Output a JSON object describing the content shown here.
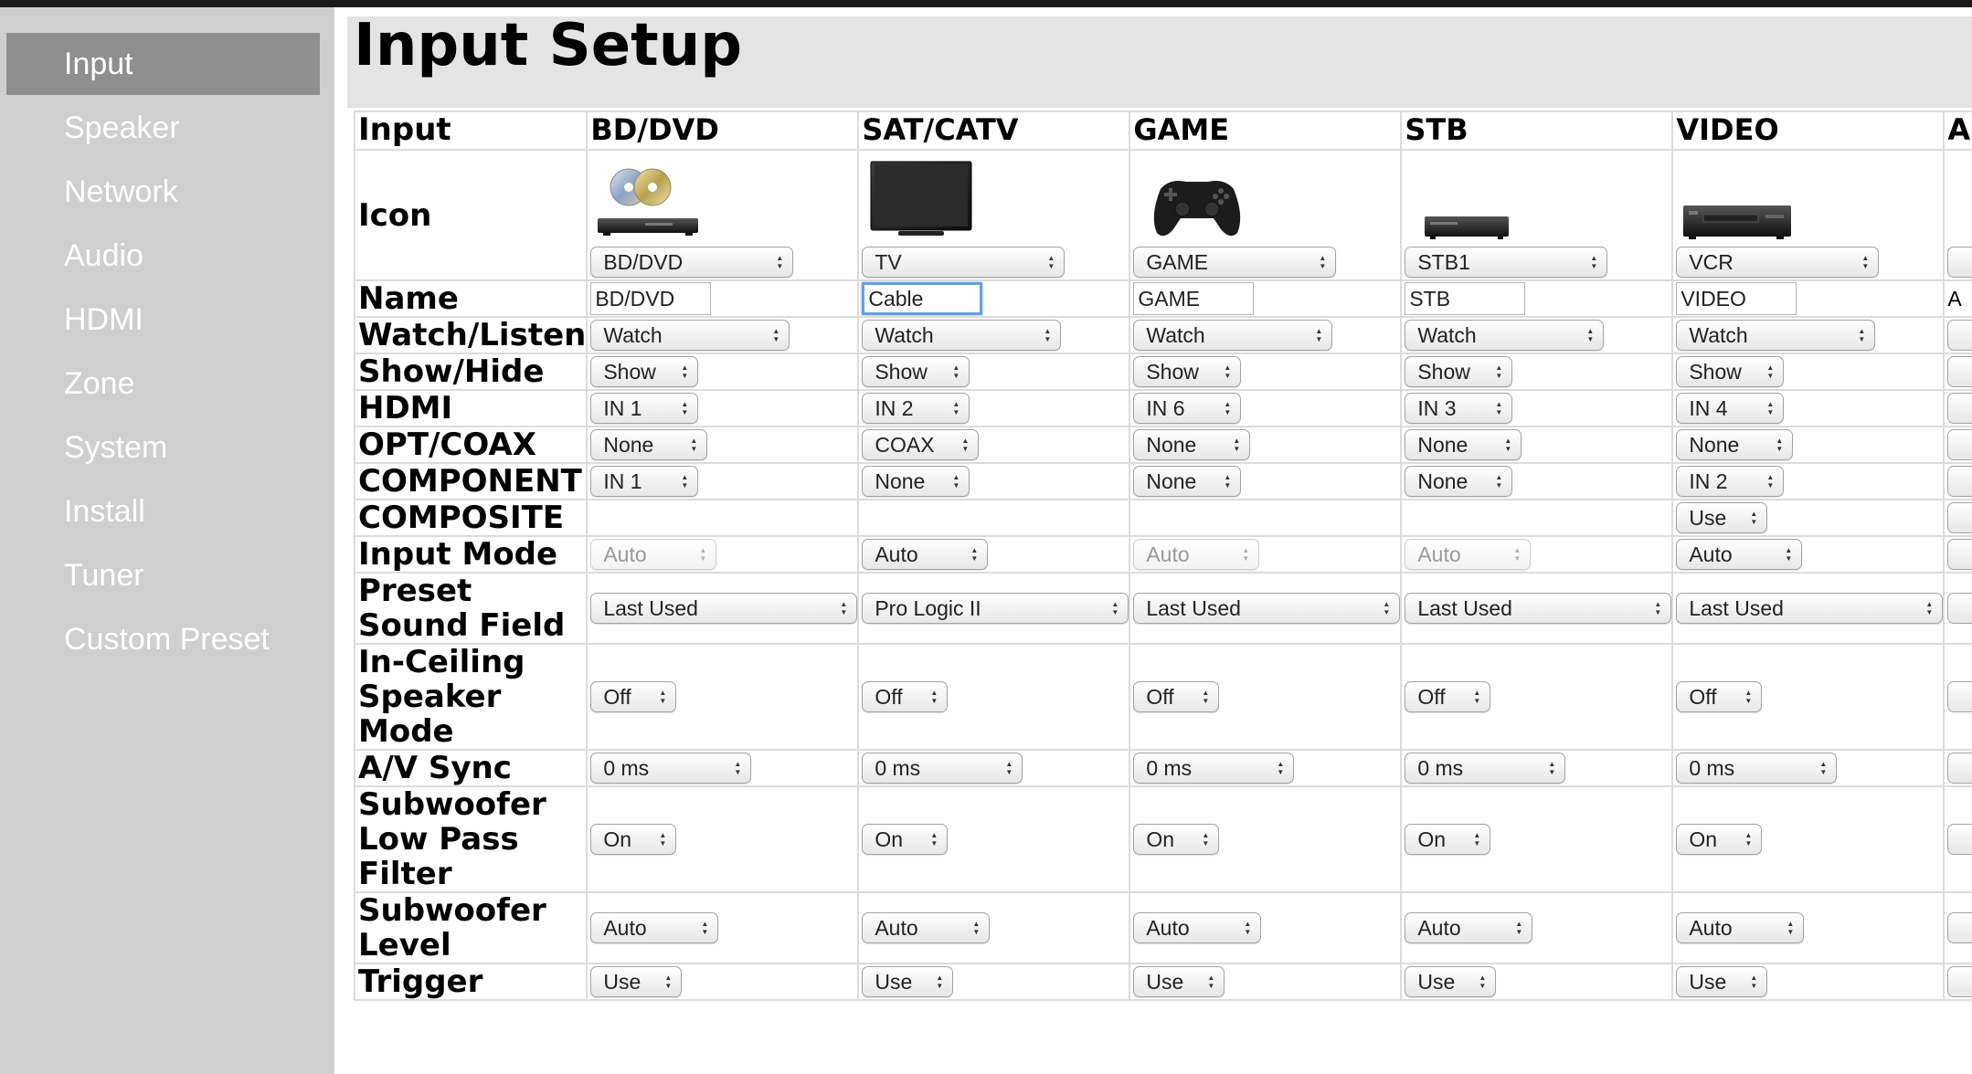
{
  "sidebar": {
    "items": [
      {
        "label": "Input",
        "active": true
      },
      {
        "label": "Speaker",
        "active": false
      },
      {
        "label": "Network",
        "active": false
      },
      {
        "label": "Audio",
        "active": false
      },
      {
        "label": "HDMI",
        "active": false
      },
      {
        "label": "Zone",
        "active": false
      },
      {
        "label": "System",
        "active": false
      },
      {
        "label": "Install",
        "active": false
      },
      {
        "label": "Tuner",
        "active": false
      },
      {
        "label": "Custom Preset",
        "active": false
      }
    ]
  },
  "page": {
    "title": "Input Setup"
  },
  "table": {
    "input_label": "Input",
    "columns": [
      {
        "header": "BD/DVD",
        "icon": "bd-dvd-player-icon",
        "icon_select": "BD/DVD",
        "name": "BD/DVD",
        "name_focused": false,
        "watch": "Watch",
        "show": "Show",
        "hdmi": "IN 1",
        "opt": "None",
        "component": "IN 1",
        "composite": "",
        "input_mode": "Auto",
        "input_mode_disabled": true,
        "sound_field": "Last Used",
        "in_ceiling": "Off",
        "av_sync": "0 ms",
        "lpf": "On",
        "sub_level": "Auto",
        "trigger": "Use"
      },
      {
        "header": "SAT/CATV",
        "icon": "tv-icon",
        "icon_select": "TV",
        "name": "Cable",
        "name_focused": true,
        "watch": "Watch",
        "show": "Show",
        "hdmi": "IN 2",
        "opt": "COAX",
        "component": "None",
        "composite": "",
        "input_mode": "Auto",
        "input_mode_disabled": false,
        "sound_field": "Pro Logic II",
        "in_ceiling": "Off",
        "av_sync": "0 ms",
        "lpf": "On",
        "sub_level": "Auto",
        "trigger": "Use"
      },
      {
        "header": "GAME",
        "icon": "game-controller-icon",
        "icon_select": "GAME",
        "name": "GAME",
        "name_focused": false,
        "watch": "Watch",
        "show": "Show",
        "hdmi": "IN 6",
        "opt": "None",
        "component": "None",
        "composite": "",
        "input_mode": "Auto",
        "input_mode_disabled": true,
        "sound_field": "Last Used",
        "in_ceiling": "Off",
        "av_sync": "0 ms",
        "lpf": "On",
        "sub_level": "Auto",
        "trigger": "Use"
      },
      {
        "header": "STB",
        "icon": "set-top-box-icon",
        "icon_select": "STB1",
        "name": "STB",
        "name_focused": false,
        "watch": "Watch",
        "show": "Show",
        "hdmi": "IN 3",
        "opt": "None",
        "component": "None",
        "composite": "",
        "input_mode": "Auto",
        "input_mode_disabled": true,
        "sound_field": "Last Used",
        "in_ceiling": "Off",
        "av_sync": "0 ms",
        "lpf": "On",
        "sub_level": "Auto",
        "trigger": "Use"
      },
      {
        "header": "VIDEO",
        "icon": "vcr-icon",
        "icon_select": "VCR",
        "name": "VIDEO",
        "name_focused": false,
        "watch": "Watch",
        "show": "Show",
        "hdmi": "IN 4",
        "opt": "None",
        "component": "IN 2",
        "composite": "Use",
        "input_mode": "Auto",
        "input_mode_disabled": false,
        "sound_field": "Last Used",
        "in_ceiling": "Off",
        "av_sync": "0 ms",
        "lpf": "On",
        "sub_level": "Auto",
        "trigger": "Use"
      },
      {
        "header": "A",
        "icon": "",
        "icon_select": "",
        "name": "A",
        "name_focused": false,
        "partial": true
      }
    ],
    "rows": [
      {
        "key": "icon",
        "label": "Icon",
        "type": "icon"
      },
      {
        "key": "name",
        "label": "Name",
        "type": "text"
      },
      {
        "key": "watch",
        "label": "Watch/Listen",
        "type": "select",
        "w": 218
      },
      {
        "key": "show",
        "label": "Show/Hide",
        "type": "select",
        "w": 118
      },
      {
        "key": "hdmi",
        "label": "HDMI",
        "type": "select",
        "w": 118
      },
      {
        "key": "opt",
        "label": "OPT/COAX",
        "type": "select",
        "w": 128
      },
      {
        "key": "component",
        "label": "COMPONENT",
        "type": "select",
        "w": 118
      },
      {
        "key": "composite",
        "label": "COMPOSITE",
        "type": "select",
        "w": 100
      },
      {
        "key": "input_mode",
        "label": "Input Mode",
        "type": "select",
        "w": 138
      },
      {
        "key": "sound_field",
        "label": "Preset Sound Field",
        "type": "select",
        "w": 292
      },
      {
        "key": "in_ceiling",
        "label": "In-Ceiling Speaker Mode",
        "type": "select",
        "w": 94
      },
      {
        "key": "av_sync",
        "label": "A/V Sync",
        "type": "select",
        "w": 176
      },
      {
        "key": "lpf",
        "label": "Subwoofer Low Pass Filter",
        "type": "select",
        "w": 94
      },
      {
        "key": "sub_level",
        "label": "Subwoofer Level",
        "type": "select",
        "w": 140
      },
      {
        "key": "trigger",
        "label": "Trigger",
        "type": "select",
        "w": 100
      }
    ]
  }
}
